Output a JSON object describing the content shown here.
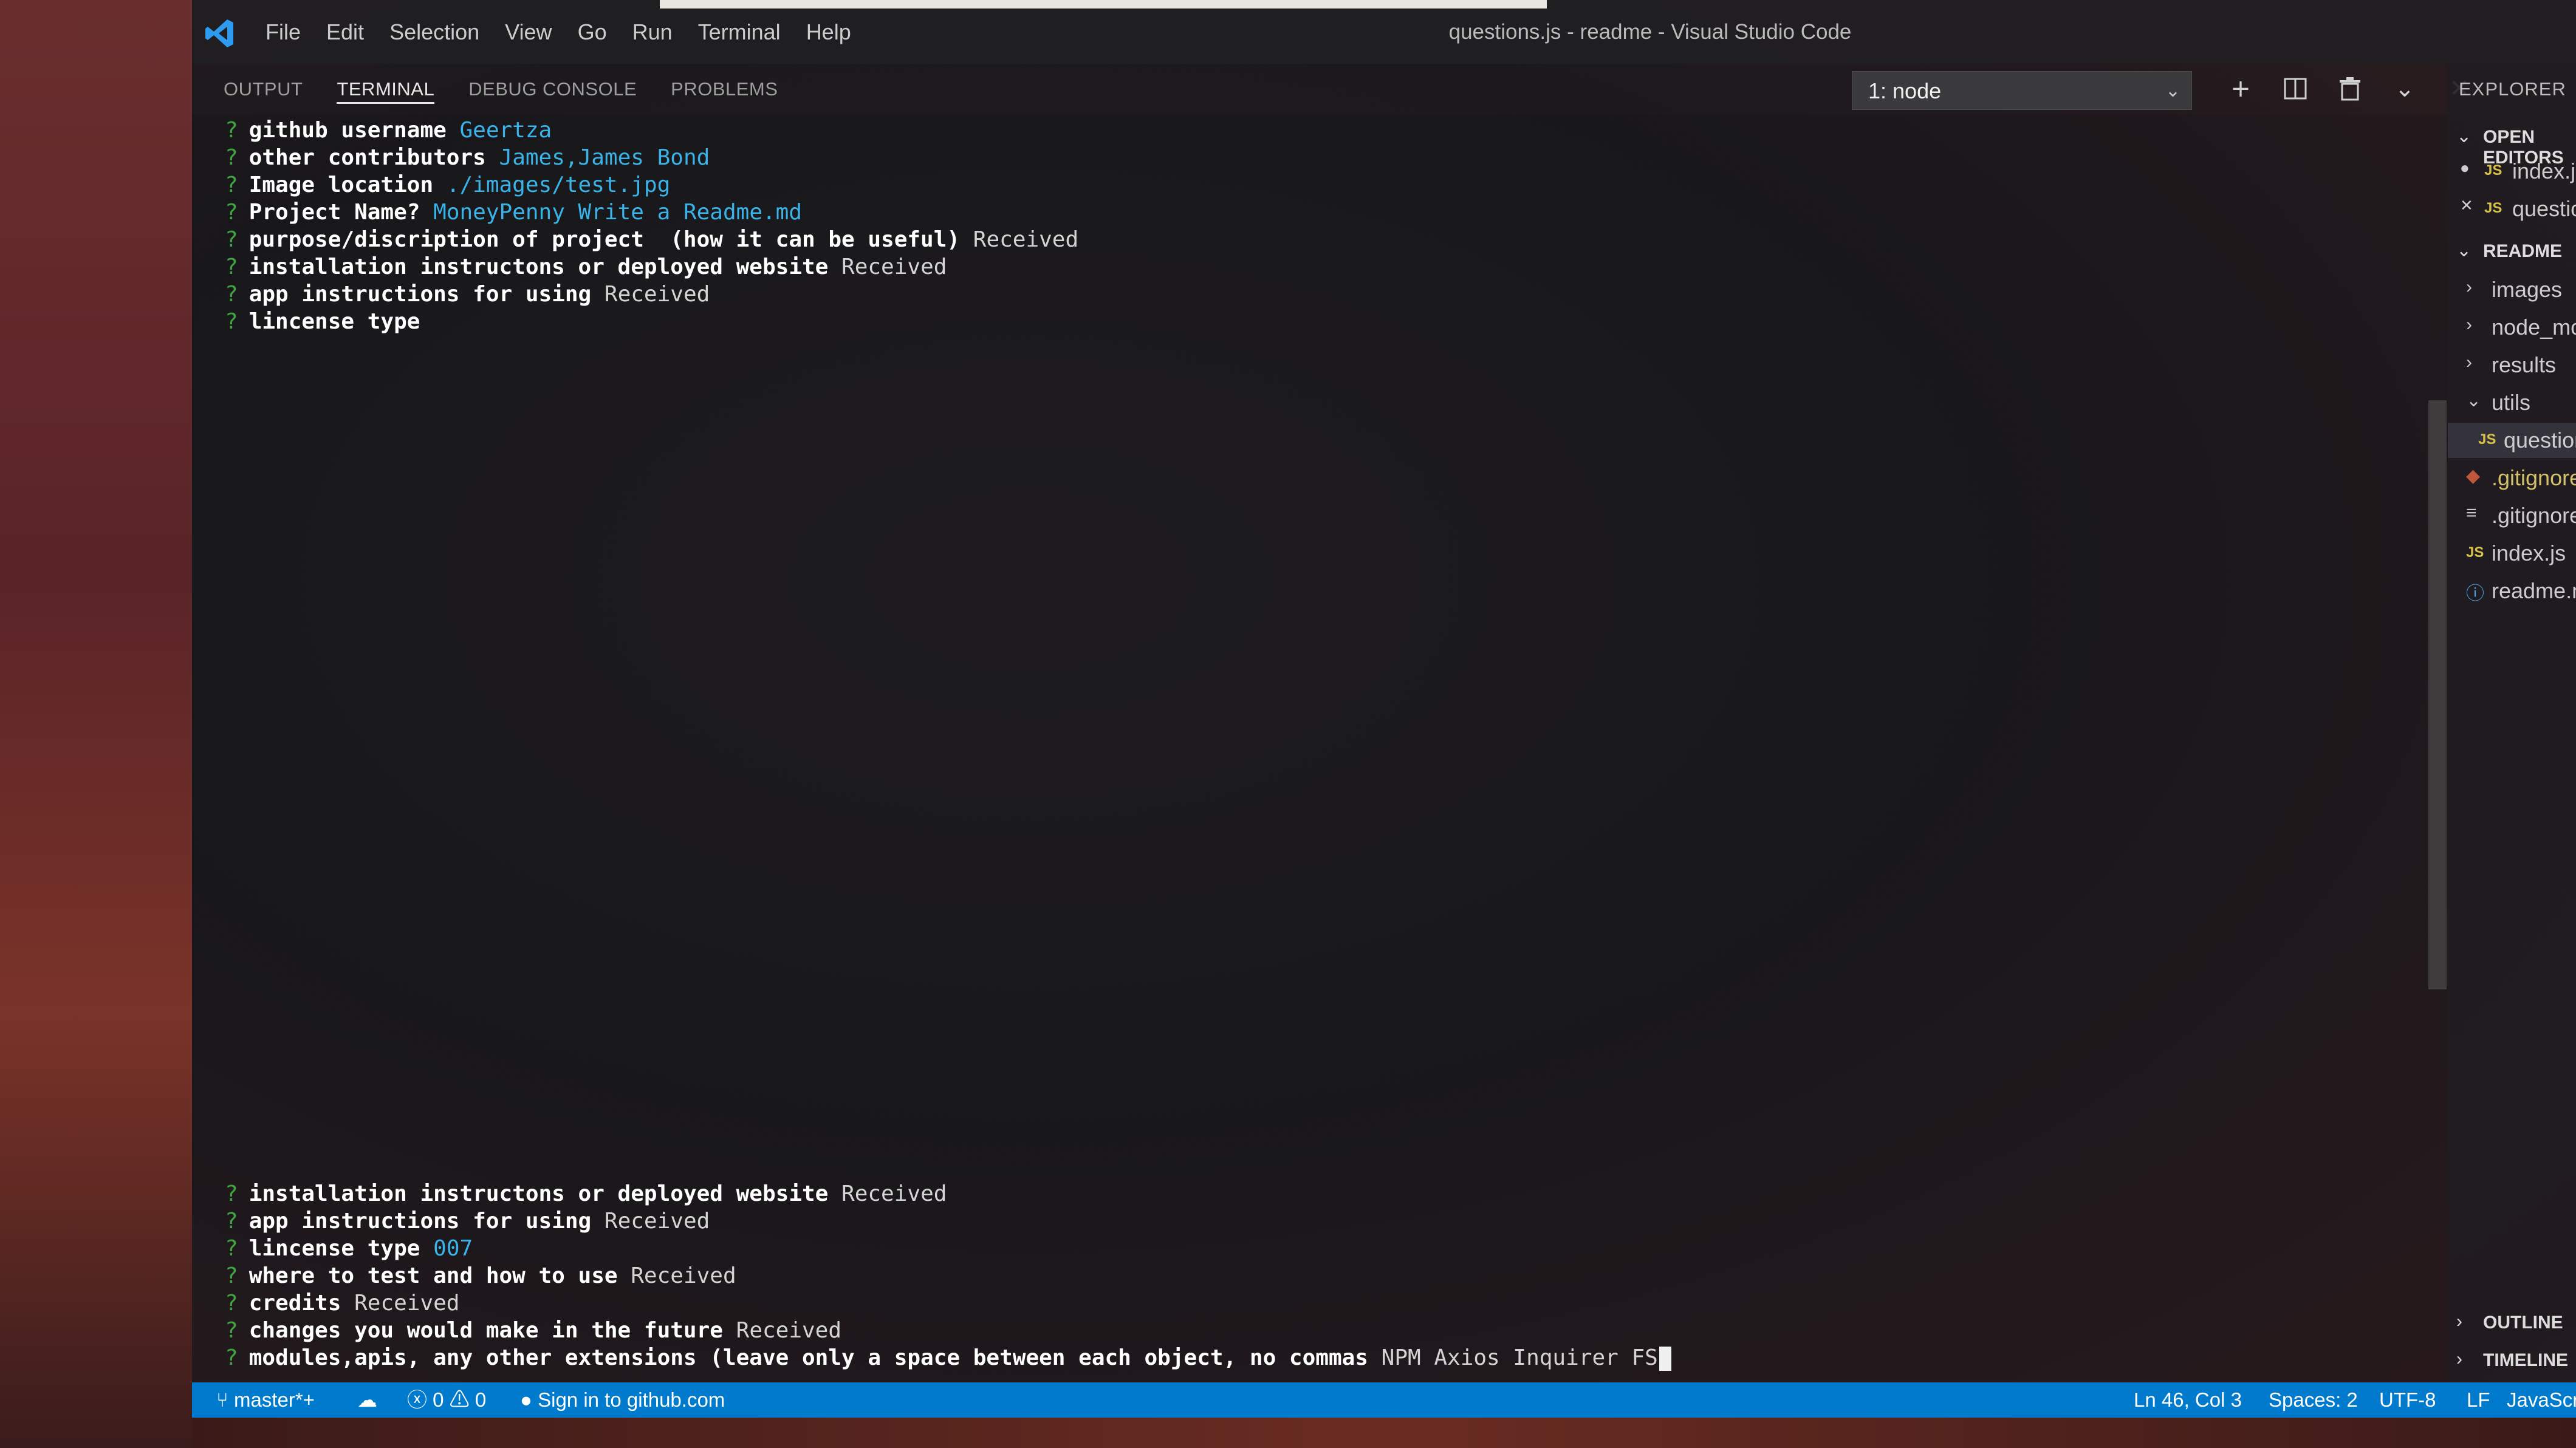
{
  "window": {
    "title": "questions.js - readme - Visual Studio Code",
    "menu": [
      "File",
      "Edit",
      "Selection",
      "View",
      "Go",
      "Run",
      "Terminal",
      "Help"
    ]
  },
  "panel": {
    "tabs": [
      "OUTPUT",
      "TERMINAL",
      "DEBUG CONSOLE",
      "PROBLEMS"
    ],
    "active_tab": "TERMINAL",
    "terminal_select": "1: node",
    "icons": [
      "plus-icon",
      "split-icon",
      "trash-icon",
      "chevron-down-icon",
      "close-icon"
    ]
  },
  "terminal": {
    "top": [
      {
        "q": "?",
        "label": "github username",
        "answer": "Geertza",
        "kind": "ans"
      },
      {
        "q": "?",
        "label": "other contributors",
        "answer": "James,James Bond",
        "kind": "ans"
      },
      {
        "q": "?",
        "label": "Image location",
        "answer": "./images/test.jpg",
        "kind": "ans"
      },
      {
        "q": "?",
        "label": "Project Name?",
        "answer": "MoneyPenny Write a Readme.md",
        "kind": "ans"
      },
      {
        "q": "?",
        "label": "purpose/discription of project  (how it can be useful)",
        "answer": "Received",
        "kind": "rec"
      },
      {
        "q": "?",
        "label": "installation instructons or deployed website",
        "answer": "Received",
        "kind": "rec"
      },
      {
        "q": "?",
        "label": "app instructions for using",
        "answer": "Received",
        "kind": "rec"
      },
      {
        "q": "?",
        "label": "lincense type",
        "answer": "",
        "kind": "rec"
      }
    ],
    "bottom": [
      {
        "q": "?",
        "label": "installation instructons or deployed website",
        "answer": "Received",
        "kind": "rec"
      },
      {
        "q": "?",
        "label": "app instructions for using",
        "answer": "Received",
        "kind": "rec"
      },
      {
        "q": "?",
        "label": "lincense type",
        "answer": "007",
        "kind": "ans"
      },
      {
        "q": "?",
        "label": "where to test and how to use",
        "answer": "Received",
        "kind": "rec"
      },
      {
        "q": "?",
        "label": "credits",
        "answer": "Received",
        "kind": "rec"
      },
      {
        "q": "?",
        "label": "changes you would make in the future",
        "answer": "Received",
        "kind": "rec"
      },
      {
        "q": "?",
        "label": "modules,apis, any other extensions (leave only a space between each object, no commas",
        "answer": "NPM Axios Inquirer FS",
        "kind": "rec"
      }
    ]
  },
  "explorer": {
    "title": "EXPLORER",
    "open_editors_label": "OPEN EDITORS",
    "open_editors": [
      {
        "marker": "●",
        "type": "JS",
        "name": "index.js"
      },
      {
        "marker": "✕",
        "type": "JS",
        "name": "questions.js"
      }
    ],
    "folder_label": "README",
    "items": [
      {
        "icon": "›",
        "name": "images",
        "indent": 1
      },
      {
        "icon": "›",
        "name": "node_modules",
        "indent": 1
      },
      {
        "icon": "›",
        "name": "results",
        "indent": 1
      },
      {
        "icon": "⌄",
        "name": "utils",
        "indent": 1
      },
      {
        "icon": "JS",
        "name": "questions.js",
        "indent": 2
      },
      {
        "icon": "◆",
        "name": ".gitignore",
        "indent": 1
      },
      {
        "icon": "≡",
        "name": ".gitignore",
        "indent": 1
      },
      {
        "icon": "JS",
        "name": "index.js",
        "indent": 1
      },
      {
        "icon": "ⓘ",
        "name": "readme.md",
        "indent": 1
      }
    ],
    "outline_label": "OUTLINE",
    "timeline_label": "TIMELINE"
  },
  "statusbar": {
    "branch": "master*+",
    "errors": "0",
    "warnings": "0",
    "sign_in": "Sign in to github.com",
    "position": "Ln 46, Col 3",
    "spaces": "Spaces: 2",
    "encoding": "UTF-8",
    "eol": "LF",
    "language": "JavaScript"
  },
  "colors": {
    "status_bar": "#007acc",
    "prompt": "#3fa33f",
    "answer": "#39b3e8"
  }
}
